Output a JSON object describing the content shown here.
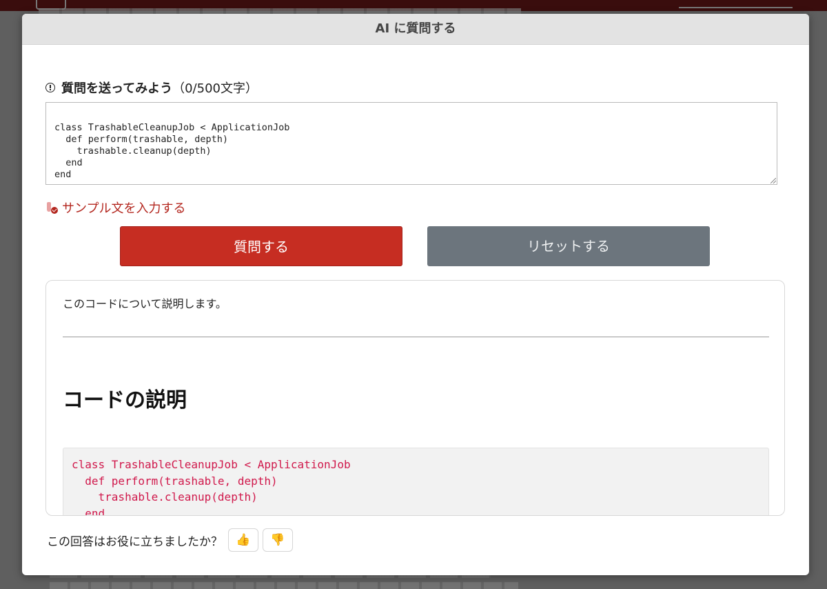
{
  "modal": {
    "title": "AI に質問する"
  },
  "question": {
    "label": "質問を送ってみよう",
    "counter": "（0/500文字）",
    "code": "class TrashableCleanupJob < ApplicationJob\n  def perform(trashable, depth)\n    trashable.cleanup(depth)\n  end\nend"
  },
  "sample_link": "サンプル文を入力する",
  "buttons": {
    "ask": "質問する",
    "reset": "リセットする"
  },
  "answer": {
    "intro": "このコードについて説明します。",
    "heading": "コードの説明",
    "code": "class TrashableCleanupJob < ApplicationJob\n  def perform(trashable, depth)\n    trashable.cleanup(depth)\n  end"
  },
  "feedback": {
    "prompt": "この回答はお役に立ちましたか？",
    "up_icon": "👍",
    "down_icon": "👎"
  },
  "colors": {
    "accent": "#c62d22",
    "secondary": "#6c757d",
    "code_text": "#d0184b"
  }
}
